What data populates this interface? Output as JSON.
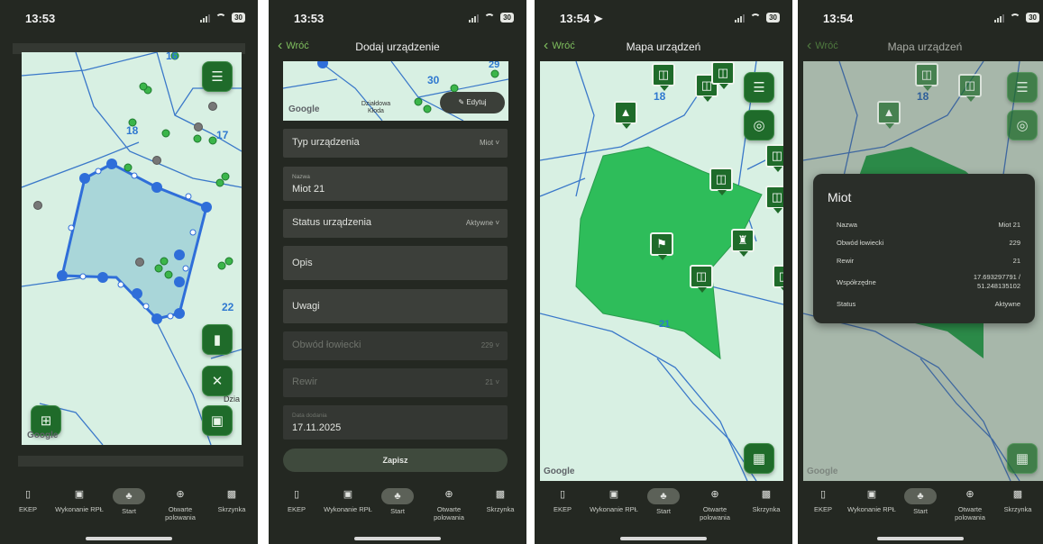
{
  "screens": [
    {
      "time": "13:53",
      "map_labels": [
        "16",
        "18",
        "17",
        "22",
        "Dzia"
      ],
      "battery": "30"
    },
    {
      "time": "13:53",
      "battery": "30",
      "back_label": "Wróć",
      "title": "Dodaj urządzenie",
      "map_labels": [
        "29",
        "30",
        "Działdowa Kłoda"
      ],
      "edit_label": "Edytuj",
      "fields": {
        "type_label": "Typ urządzenia",
        "type_value": "Miot",
        "name_caption": "Nazwa",
        "name_value": "Miot 21",
        "status_label": "Status urządzenia",
        "status_value": "Aktywne",
        "desc_label": "Opis",
        "notes_label": "Uwagi",
        "district_label": "Obwód łowiecki",
        "district_value": "229",
        "rewir_label": "Rewir",
        "rewir_value": "21",
        "date_caption": "Data dodania",
        "date_value": "17.11.2025"
      },
      "save_label": "Zapisz"
    },
    {
      "time": "13:54",
      "battery": "30",
      "back_label": "Wróć",
      "title": "Mapa urządzeń",
      "map_labels": [
        "18",
        "21"
      ]
    },
    {
      "time": "13:54",
      "battery": "30",
      "back_label": "Wróć",
      "title": "Mapa urządzeń",
      "map_labels": [
        "18"
      ],
      "info": {
        "title": "Miot",
        "rows": [
          {
            "key": "Nazwa",
            "value": "Miot 21"
          },
          {
            "key": "Obwód łowiecki",
            "value": "229"
          },
          {
            "key": "Rewir",
            "value": "21"
          },
          {
            "key": "Współrzędne",
            "value": "17.693297791 / 51.248135102"
          },
          {
            "key": "Status",
            "value": "Aktywne"
          }
        ]
      }
    }
  ],
  "tabbar": {
    "items": [
      {
        "label": "EKEP",
        "icon": "document-icon"
      },
      {
        "label": "Wykonanie RPŁ",
        "icon": "calendar-icon"
      },
      {
        "label": "Start",
        "icon": "tree-icon"
      },
      {
        "label": "Otwarte polowania",
        "icon": "crosshair-icon"
      },
      {
        "label": "Skrzynka",
        "icon": "inbox-icon"
      }
    ]
  },
  "google_label": "Google",
  "colors": {
    "background": "#242822",
    "accent": "#1f6b2a",
    "map": "#d8f0e3",
    "polygon": "#2ebd5a",
    "selection": "#2f6ed9"
  }
}
